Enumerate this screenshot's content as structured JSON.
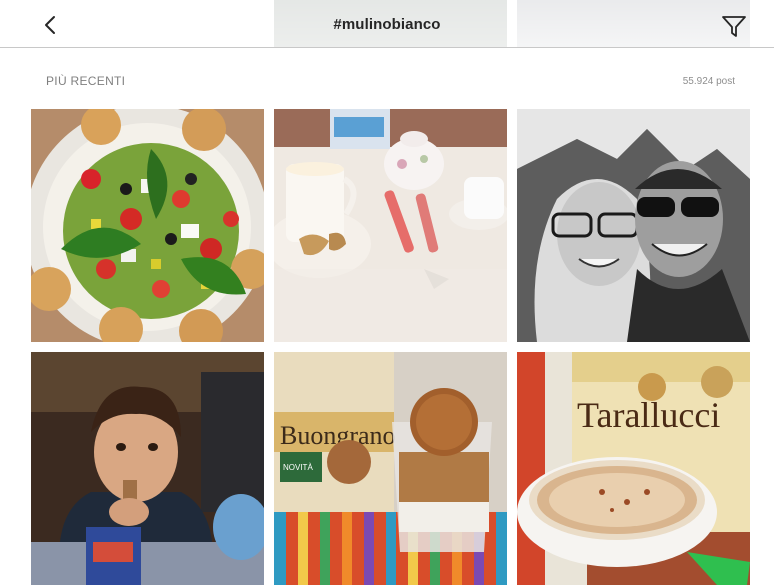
{
  "header": {
    "title": "#mulinobianco",
    "back_icon": "chevron-left-icon",
    "filter_icon": "filter-icon"
  },
  "section": {
    "label": "PIÙ RECENTI",
    "count": "55.924 post"
  },
  "posts": [
    {
      "subject": "salad-photo"
    },
    {
      "subject": "breakfast-table-photo"
    },
    {
      "subject": "couple-selfie-photo"
    },
    {
      "subject": "boy-eating-snack-photo"
    },
    {
      "subject": "buongrano-biscuits-photo",
      "text": "Buongrano",
      "badge": "NOVITÀ"
    },
    {
      "subject": "tarallucci-cappuccino-photo",
      "text": "Tarallucci"
    }
  ],
  "colors": {
    "header_bg": "#ffffff",
    "divider": "#c8c8c8",
    "title": "#262626",
    "muted": "#8e8e8e"
  }
}
